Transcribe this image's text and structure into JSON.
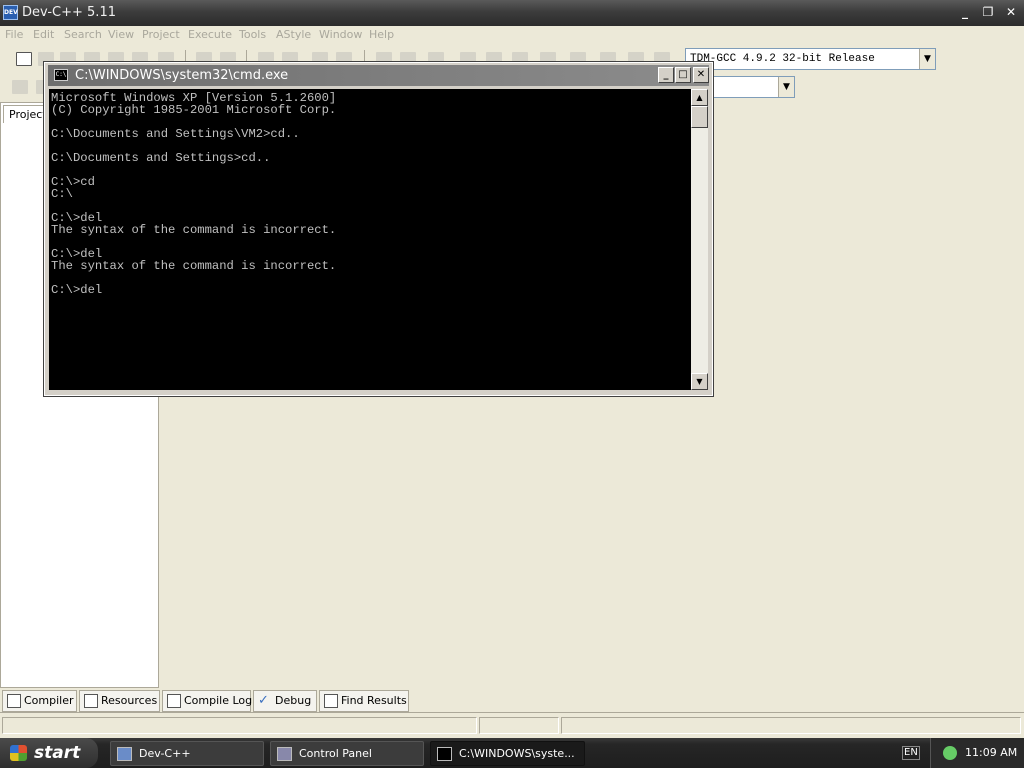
{
  "devcpp": {
    "title": "Dev-C++ 5.11",
    "icon_text": "DEV",
    "title_buttons": [
      "_",
      "❐",
      "✕"
    ],
    "menu": [
      "File",
      "Edit",
      "Search",
      "View",
      "Project",
      "Execute",
      "Tools",
      "AStyle",
      "Window",
      "Help"
    ],
    "compiler_select": "TDM-GCC 4.9.2 32-bit Release",
    "second_select": "",
    "project_tab": "Project",
    "bottom_tabs": [
      "Compiler",
      "Resources",
      "Compile Log",
      "Debug",
      "Find Results"
    ]
  },
  "cmd": {
    "title": "C:\\WINDOWS\\system32\\cmd.exe",
    "icon_text": "C:\\",
    "buttons": [
      "_",
      "□",
      "✕"
    ],
    "lines": [
      "Microsoft Windows XP [Version 5.1.2600]",
      "(C) Copyright 1985-2001 Microsoft Corp.",
      "",
      "C:\\Documents and Settings\\VM2>cd..",
      "",
      "C:\\Documents and Settings>cd..",
      "",
      "C:\\>cd",
      "C:\\",
      "",
      "C:\\>del",
      "The syntax of the command is incorrect.",
      "",
      "C:\\>del",
      "The syntax of the command is incorrect.",
      "",
      "C:\\>del"
    ],
    "scroll_up": "▲",
    "scroll_down": "▼"
  },
  "taskbar": {
    "start_label": "start",
    "tasks": [
      {
        "label": "Dev-C++",
        "active": false
      },
      {
        "label": "Control Panel",
        "active": false
      },
      {
        "label": "C:\\WINDOWS\\syste...",
        "active": true
      }
    ],
    "language": "EN",
    "time": "11:09 AM"
  },
  "colors": {
    "console_bg": "#000000",
    "console_fg": "#c0c0c0",
    "window_bg": "#ece9d8",
    "taskbar": "#1e1e1e"
  }
}
